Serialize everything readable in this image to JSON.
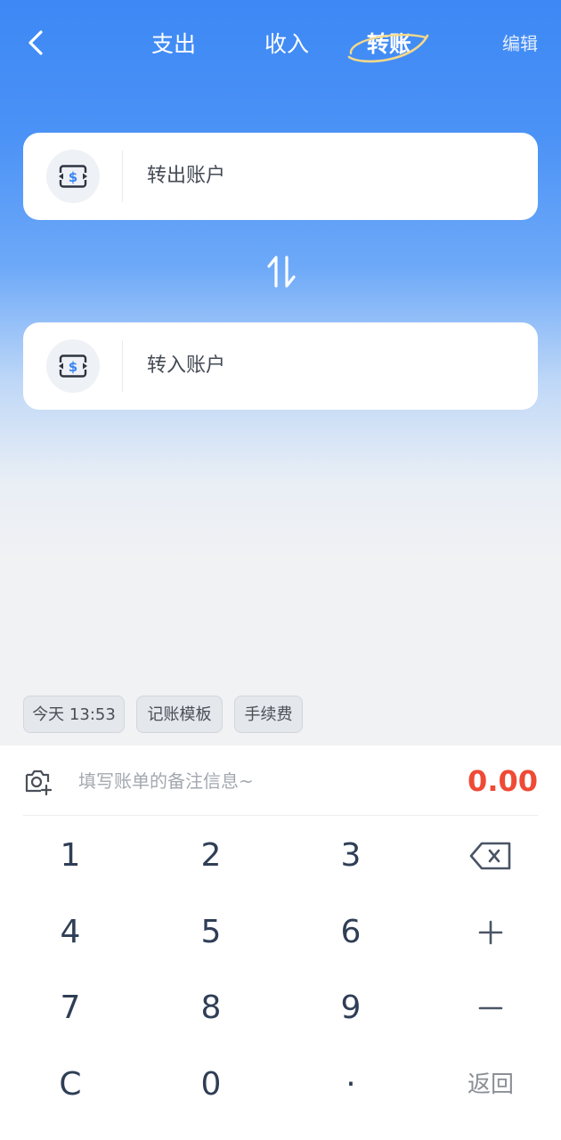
{
  "header": {
    "back_icon": "chevron-left-icon",
    "tabs": [
      {
        "label": "支出"
      },
      {
        "label": "收入"
      },
      {
        "label": "转账",
        "active": true
      }
    ],
    "edit_label": "编辑"
  },
  "transfer": {
    "from_label": "转出账户",
    "to_label": "转入账户",
    "account_icon": "money-exchange-icon",
    "swap_icon": "swap-vertical-icon"
  },
  "chips": {
    "date": "今天 13:53",
    "template": "记账模板",
    "fee": "手续费"
  },
  "entry": {
    "camera_icon": "camera-add-icon",
    "note_placeholder": "填写账单的备注信息~",
    "amount": "0.00"
  },
  "keypad": {
    "keys": [
      "1",
      "2",
      "3",
      "4",
      "5",
      "6",
      "7",
      "8",
      "9",
      "C",
      "0",
      "·"
    ],
    "backspace_icon": "backspace-icon",
    "plus_icon": "plus-icon",
    "minus_icon": "minus-icon",
    "return_label": "返回"
  },
  "colors": {
    "header_blue": "#3d88f5",
    "amount_red": "#ef4a35",
    "key_text": "#2f3e56",
    "account_icon_blue": "#3a84f2"
  }
}
